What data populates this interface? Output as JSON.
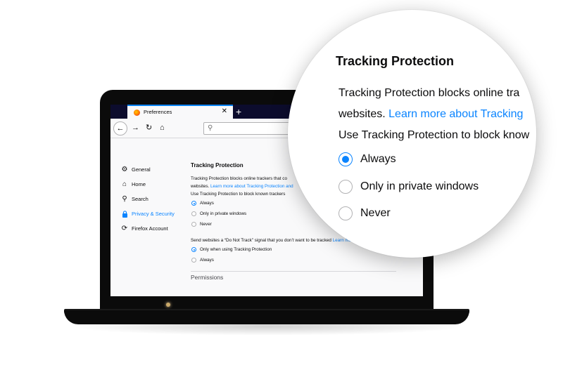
{
  "browser": {
    "tab_title": "Preferences",
    "tab_close": "✕",
    "new_tab": "+",
    "back": "←",
    "forward": "→",
    "reload": "↻",
    "home": "⌂",
    "search_glyph": "⚲"
  },
  "sidebar": {
    "items": [
      {
        "label": "General",
        "icon": "⚙",
        "icon_name": "gear-icon",
        "active": false
      },
      {
        "label": "Home",
        "icon": "⌂",
        "icon_name": "home-icon",
        "active": false
      },
      {
        "label": "Search",
        "icon": "⚲",
        "icon_name": "search-icon",
        "active": false
      },
      {
        "label": "Privacy & Security",
        "icon": "🔒",
        "icon_name": "lock-icon",
        "active": true
      },
      {
        "label": "Firefox Account",
        "icon": "⟳",
        "icon_name": "sync-icon",
        "active": false
      }
    ]
  },
  "content": {
    "tracking_heading": "Tracking Protection",
    "tracking_line1": "Tracking Protection blocks online trackers that co",
    "tracking_line2_prefix": "websites. ",
    "tracking_line2_link": "Learn more about Tracking Protection and",
    "tracking_line3": "Use Tracking Protection to block known trackers",
    "tracking_options": [
      "Always",
      "Only in private windows",
      "Never"
    ],
    "tracking_selected": 0,
    "dnt_text": "Send websites a “Do Not Track” signal that you don’t want to be tracked",
    "dnt_link": "Learn mo",
    "dnt_options": [
      "Only when using Tracking Protection",
      "Always"
    ],
    "dnt_selected": 0,
    "permissions_heading": "Permissions"
  },
  "magnifier": {
    "title": "Tracking Protection",
    "line1": "Tracking Protection blocks online tra",
    "line2_prefix": "websites. ",
    "line2_link": "Learn more about Tracking",
    "line3": "Use Tracking Protection to block know",
    "options": [
      "Always",
      "Only in private windows",
      "Never"
    ],
    "selected": 0
  },
  "colors": {
    "accent": "#0a84ff",
    "tabstrip": "#0c0c2d",
    "laptop": "#0b0b0b"
  }
}
